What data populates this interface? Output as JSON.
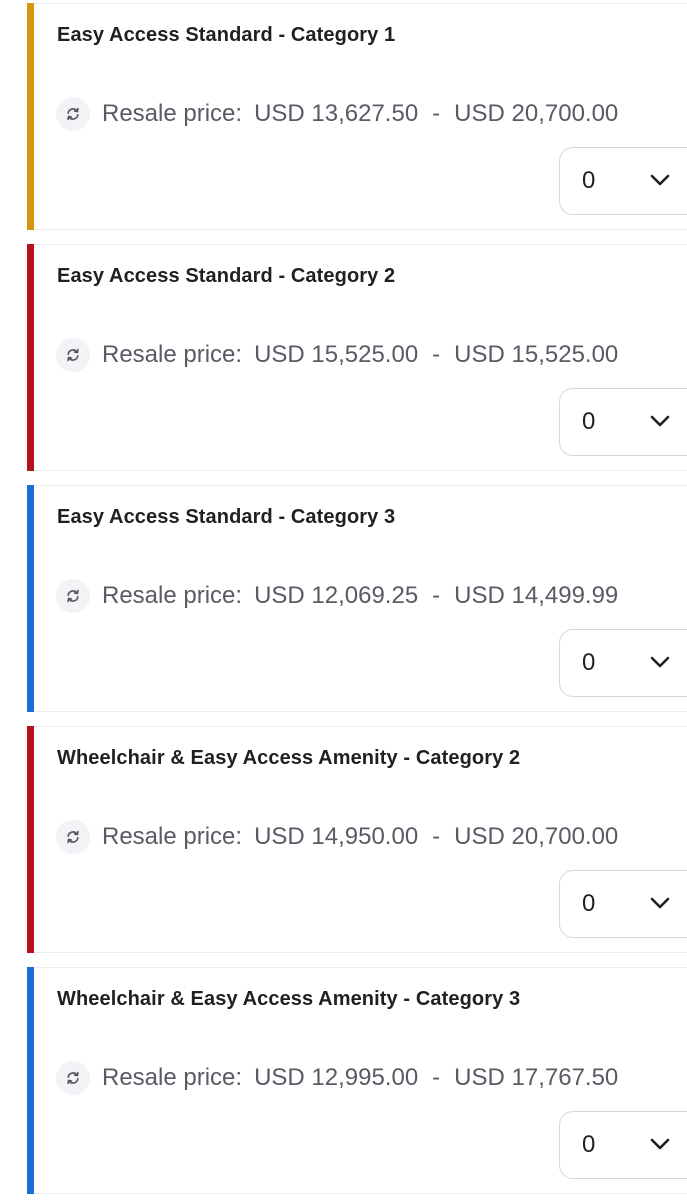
{
  "listings": [
    {
      "title": "Easy Access Standard - Category 1",
      "price_label": "Resale price:",
      "price_min": "USD 13,627.50",
      "separator": "-",
      "price_max": "USD 20,700.00",
      "quantity": "0",
      "accent_color": "#d4950f"
    },
    {
      "title": "Easy Access Standard - Category 2",
      "price_label": "Resale price:",
      "price_min": "USD 15,525.00",
      "separator": "-",
      "price_max": "USD 15,525.00",
      "quantity": "0",
      "accent_color": "#b3111b"
    },
    {
      "title": "Easy Access Standard - Category 3",
      "price_label": "Resale price:",
      "price_min": "USD 12,069.25",
      "separator": "-",
      "price_max": "USD 14,499.99",
      "quantity": "0",
      "accent_color": "#1a6fd6"
    },
    {
      "title": "Wheelchair & Easy Access Amenity - Category 2",
      "price_label": "Resale price:",
      "price_min": "USD 14,950.00",
      "separator": "-",
      "price_max": "USD 20,700.00",
      "quantity": "0",
      "accent_color": "#b3111b"
    },
    {
      "title": "Wheelchair & Easy Access Amenity - Category 3",
      "price_label": "Resale price:",
      "price_min": "USD 12,995.00",
      "separator": "-",
      "price_max": "USD 17,767.50",
      "quantity": "0",
      "accent_color": "#1a6fd6"
    }
  ],
  "icons": {
    "resale": "resale-cycle-icon",
    "dropdown": "chevron-down-icon"
  }
}
